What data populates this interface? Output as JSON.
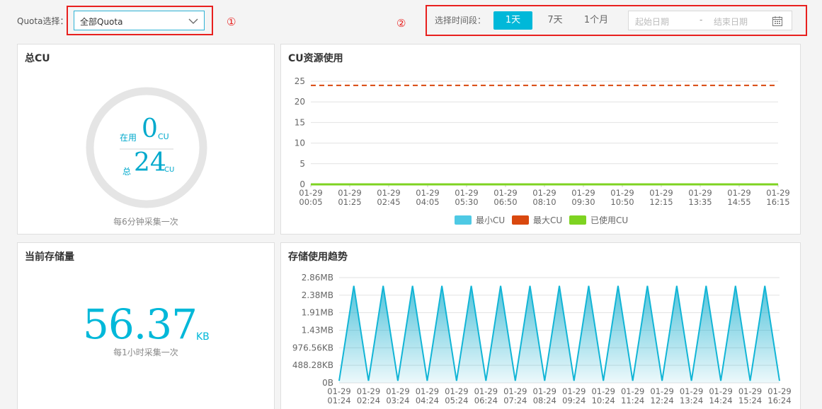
{
  "filters": {
    "quota_label": "Quota选择：",
    "quota_value": "全部Quota",
    "marker1": "①",
    "marker2": "②",
    "time_label": "选择时间段：",
    "time_options": [
      "1天",
      "7天",
      "1个月"
    ],
    "active_option": "1天",
    "start_placeholder": "起始日期",
    "range_sep": "-",
    "end_placeholder": "结束日期"
  },
  "total_cu": {
    "title": "总CU",
    "in_use_label": "在用",
    "in_use_value": "0",
    "unit": "CU",
    "total_label": "总",
    "total_value": "24",
    "total_unit": "CU",
    "note": "每6分钟采集一次"
  },
  "storage": {
    "title": "当前存储量",
    "value": "56.37",
    "unit": "KB",
    "note": "每1小时采集一次"
  },
  "colors": {
    "accent": "#00b8d9",
    "min_cu": "#4ec9e4",
    "max_cu": "#d9480f",
    "used_cu": "#7ed321",
    "highlight_box": "#e8201e"
  },
  "chart_data": [
    {
      "type": "line",
      "title": "CU资源使用",
      "x": [
        "01-29 00:05",
        "01-29 01:25",
        "01-29 02:45",
        "01-29 04:05",
        "01-29 05:30",
        "01-29 06:50",
        "01-29 08:10",
        "01-29 09:30",
        "01-29 10:50",
        "01-29 12:15",
        "01-29 13:35",
        "01-29 14:55",
        "01-29 16:15"
      ],
      "yticks": [
        "0",
        "5",
        "10",
        "15",
        "20",
        "25"
      ],
      "ylim": [
        0,
        25
      ],
      "grid": true,
      "legend_position": "bottom",
      "series": [
        {
          "name": "最小CU",
          "values": [
            0,
            0,
            0,
            0,
            0,
            0,
            0,
            0,
            0,
            0,
            0,
            0,
            0
          ]
        },
        {
          "name": "最大CU",
          "values": [
            24,
            24,
            24,
            24,
            24,
            24,
            24,
            24,
            24,
            24,
            24,
            24,
            24
          ]
        },
        {
          "name": "已使用CU",
          "values": [
            0,
            0,
            0,
            0,
            0,
            0,
            0,
            0,
            0,
            0,
            0,
            0,
            0
          ]
        }
      ]
    },
    {
      "type": "area",
      "title": "存储使用趋势",
      "x": [
        "01-29 01:24",
        "01-29 02:24",
        "01-29 03:24",
        "01-29 04:24",
        "01-29 05:24",
        "01-29 06:24",
        "01-29 07:24",
        "01-29 08:24",
        "01-29 09:24",
        "01-29 10:24",
        "01-29 11:24",
        "01-29 12:24",
        "01-29 13:24",
        "01-29 14:24",
        "01-29 15:24",
        "01-29 16:24"
      ],
      "yticks": [
        "0B",
        "488.28KB",
        "976.56KB",
        "1.43MB",
        "1.91MB",
        "2.38MB",
        "2.86MB"
      ],
      "ylim_kb": [
        0,
        2929.7
      ],
      "peak_kb": 2700,
      "trough_kb": 56.37,
      "peaks": 15,
      "grid": true
    }
  ]
}
